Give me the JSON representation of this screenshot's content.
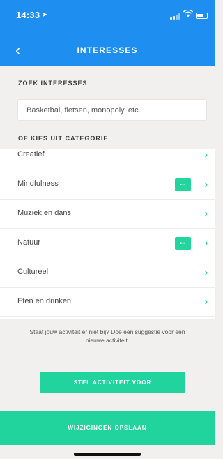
{
  "status_bar": {
    "time": "14:33"
  },
  "header": {
    "title": "INTERESSES"
  },
  "search": {
    "section_label": "ZOEK INTERESSES",
    "placeholder": "Basketbal, fietsen, monopoly, etc."
  },
  "categories": {
    "section_label": "OF KIES UIT CATEGORIE",
    "items": [
      {
        "label": "Creatief",
        "badge": ""
      },
      {
        "label": "Mindfulness",
        "badge": "..."
      },
      {
        "label": "Muziek en dans",
        "badge": ""
      },
      {
        "label": "Natuur",
        "badge": "..."
      },
      {
        "label": "Cultureel",
        "badge": ""
      },
      {
        "label": "Eten en drinken",
        "badge": ""
      }
    ]
  },
  "suggestion": {
    "text": "Staat jouw activiteit er niet bij? Doe een suggestie voor een nieuwe activiteit.",
    "button_label": "STEL ACTIVITEIT VOOR"
  },
  "footer": {
    "save_label": "WIJZIGINGEN OPSLAAN"
  },
  "colors": {
    "header_blue": "#1e8ff0",
    "accent_green": "#21d39d"
  }
}
